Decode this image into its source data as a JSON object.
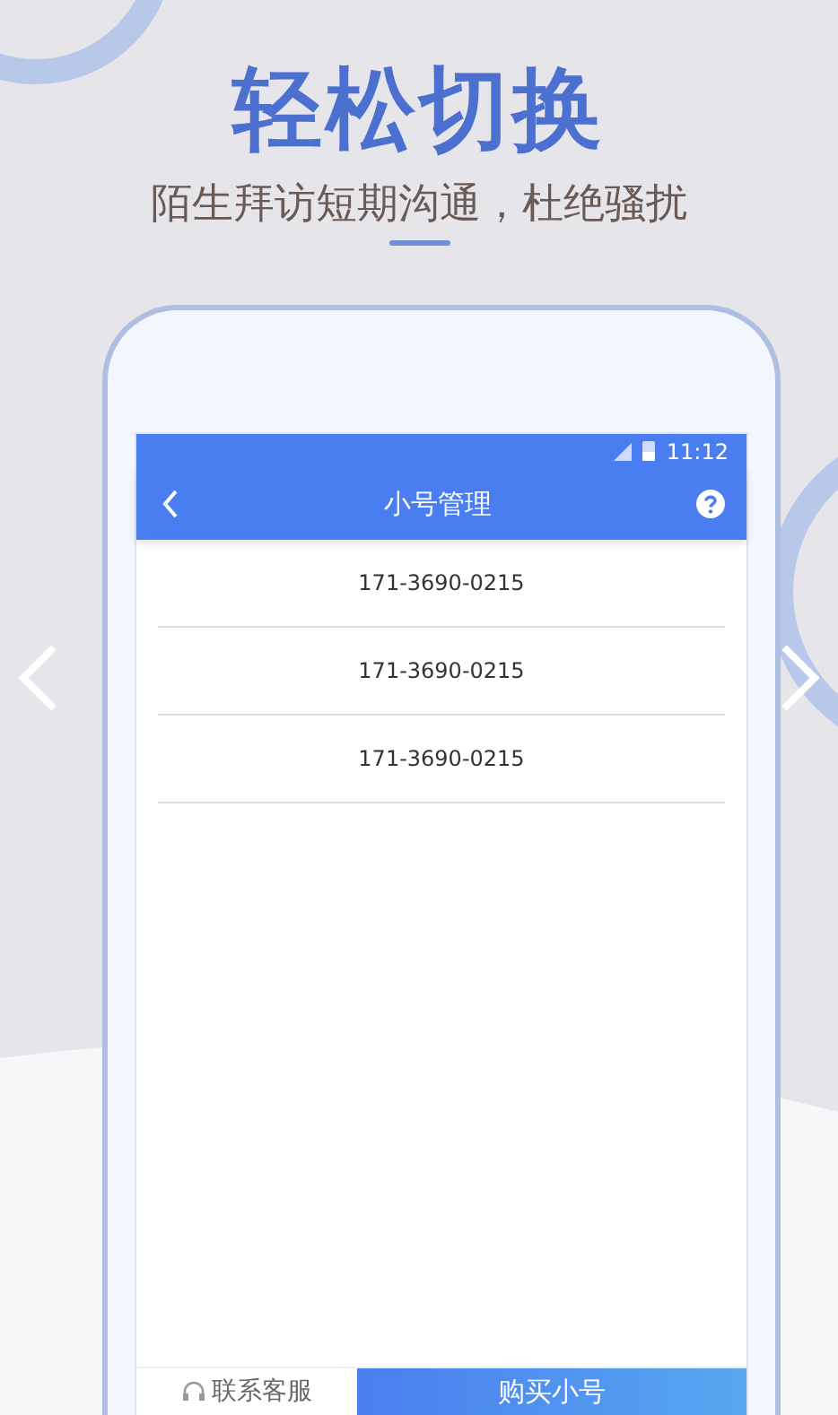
{
  "headline": "轻松切换",
  "subtitle": "陌生拜访短期沟通，杜绝骚扰",
  "phone": {
    "status_bar": {
      "time": "11:12"
    },
    "nav_bar": {
      "title": "小号管理"
    },
    "numbers": [
      "171-3690-0215",
      "171-3690-0215",
      "171-3690-0215"
    ],
    "bottom_bar": {
      "contact": "联系客服",
      "buy": "购买小号"
    }
  }
}
